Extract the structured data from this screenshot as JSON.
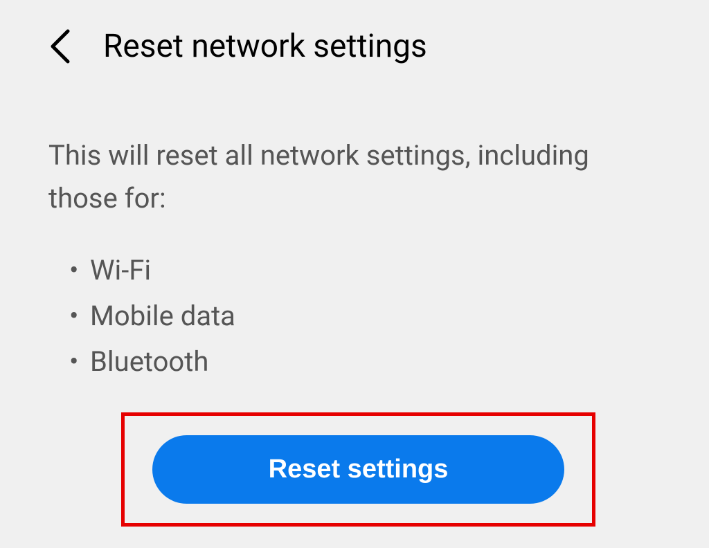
{
  "header": {
    "title": "Reset network settings"
  },
  "description": "This will reset all network settings, including those for:",
  "items": [
    "Wi-Fi",
    "Mobile data",
    "Bluetooth"
  ],
  "button": {
    "label": "Reset settings"
  },
  "colors": {
    "accent": "#0a7aec",
    "highlight": "#e60000"
  }
}
